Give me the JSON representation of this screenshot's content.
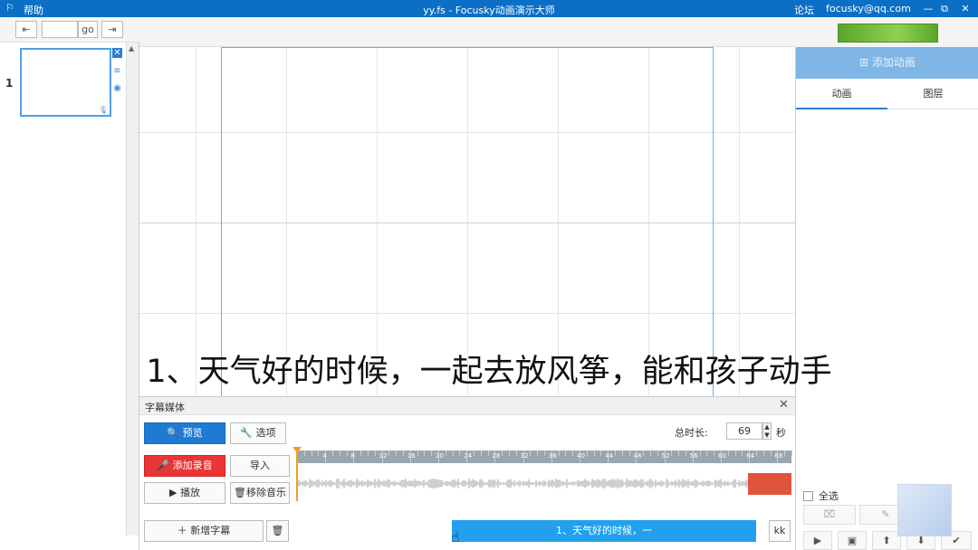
{
  "titlebar": {
    "menu_help": "帮助",
    "window_title": "yy.fs - Focusky动画演示大师",
    "forum": "论坛",
    "email": "focusky@qq.com",
    "minimize": "—",
    "restore": "⧉",
    "close": "✕"
  },
  "leftnav": {
    "first": "⇤",
    "go": "go",
    "last": "⇥",
    "page_input_value": ""
  },
  "slides": [
    {
      "number": "1"
    }
  ],
  "subtitle_overlay": "1、天气好的时候，一起去放风筝，能和孩子动手",
  "right": {
    "add_animation": "添加动画",
    "tab_animation": "动画",
    "tab_layer": "图层",
    "select_all": "全选"
  },
  "media": {
    "title": "字幕媒体",
    "preview": "预览",
    "options": "选项",
    "total_duration_label": "总时长:",
    "total_duration_value": "69",
    "duration_unit": "秒",
    "add_recording": "添加录音",
    "import": "导入",
    "play": "播放",
    "remove_music": "移除音乐",
    "add_subtitle": "新增字幕",
    "subtitle_clip_text": "1、天气好的时候，一",
    "kk": "kk",
    "ruler_labels": [
      "4",
      "8",
      "12",
      "16",
      "20",
      "24",
      "28",
      "32",
      "36",
      "40",
      "44",
      "48",
      "52",
      "56",
      "60",
      "64",
      "68"
    ]
  },
  "colors": {
    "titlebar": "#0b6fc6",
    "accent_blue": "#1f7ad4",
    "record_red": "#e93535",
    "clip_blue": "#22a0ee",
    "audio_clip": "#e0533c",
    "go_green": "#6cba35"
  }
}
